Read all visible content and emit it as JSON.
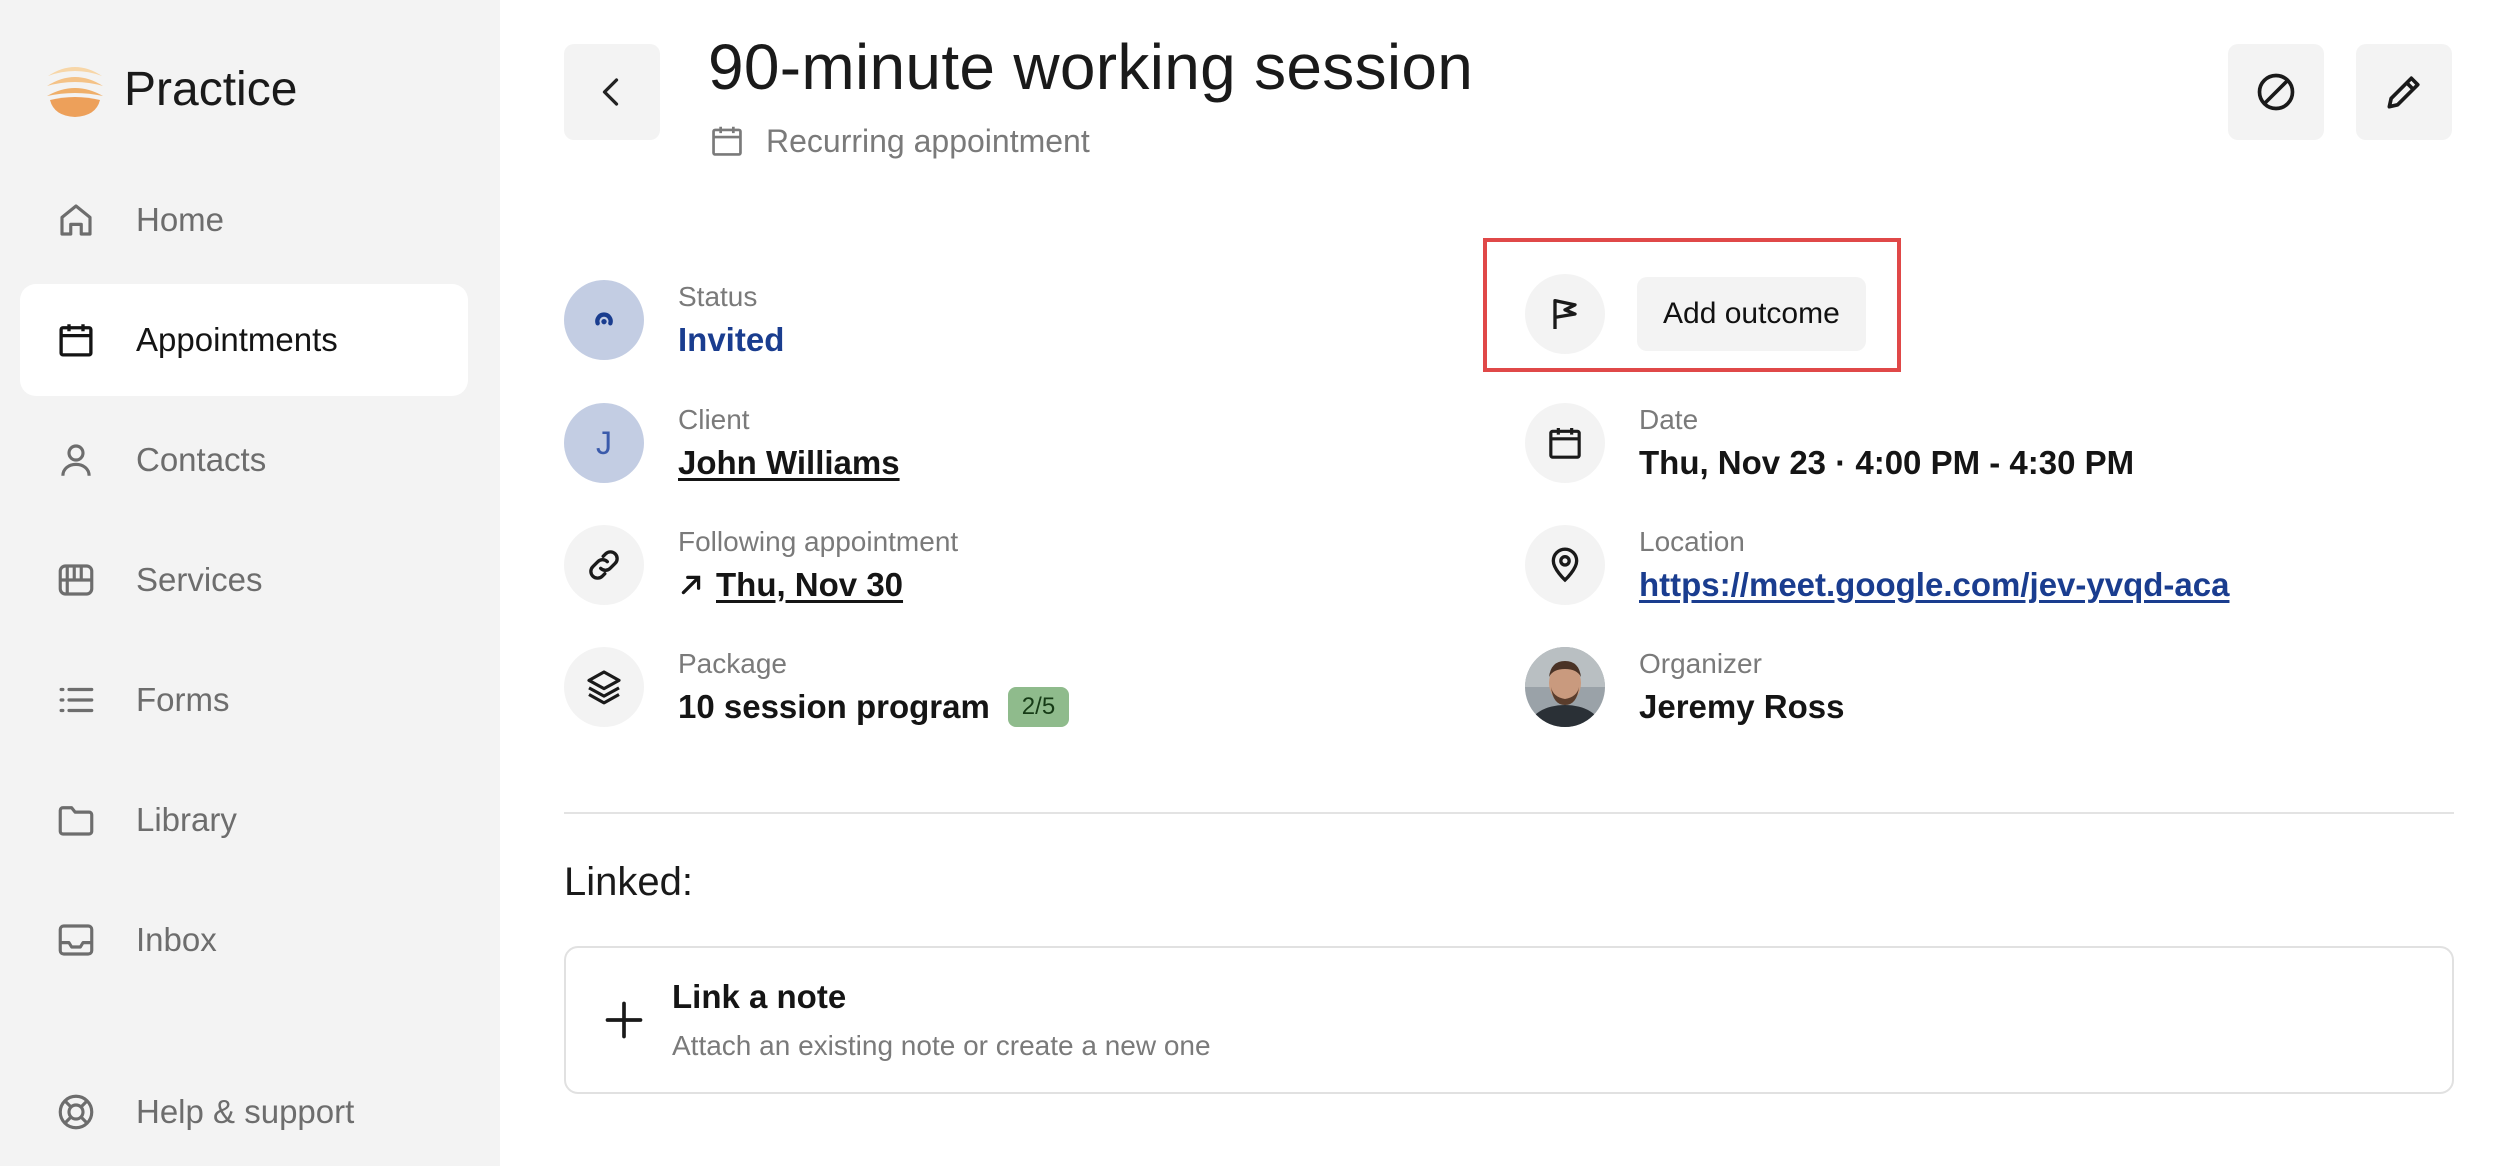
{
  "brand": {
    "name": "Practice"
  },
  "sidebar": {
    "items": [
      {
        "label": "Home",
        "icon": "home-icon"
      },
      {
        "label": "Appointments",
        "icon": "calendar-icon",
        "active": true
      },
      {
        "label": "Contacts",
        "icon": "person-icon"
      },
      {
        "label": "Services",
        "icon": "services-icon"
      },
      {
        "label": "Forms",
        "icon": "list-icon"
      },
      {
        "label": "Library",
        "icon": "folder-icon"
      },
      {
        "label": "Inbox",
        "icon": "inbox-icon"
      },
      {
        "label": "Help & support",
        "icon": "lifebuoy-icon"
      }
    ]
  },
  "header": {
    "title": "90-minute working session",
    "subtitle": "Recurring appointment"
  },
  "details": {
    "status": {
      "label": "Status",
      "value": "Invited"
    },
    "client": {
      "label": "Client",
      "value": "John Williams",
      "initial": "J"
    },
    "following": {
      "label": "Following appointment",
      "value": "Thu, Nov 30"
    },
    "package": {
      "label": "Package",
      "value": "10 session program",
      "badge": "2/5"
    },
    "outcome": {
      "button": "Add outcome"
    },
    "date": {
      "label": "Date",
      "value": "Thu, Nov 23 · 4:00 PM - 4:30 PM"
    },
    "location": {
      "label": "Location",
      "value": "https://meet.google.com/jev-yvqd-aca"
    },
    "organizer": {
      "label": "Organizer",
      "value": "Jeremy Ross"
    }
  },
  "linked": {
    "heading": "Linked:",
    "card_title": "Link a note",
    "card_subtitle": "Attach an existing note or create a new one"
  },
  "colors": {
    "sidebar_bg": "#f3f3f3",
    "status_blue": "#1a3d8f",
    "badge_green": "#8fbb8c",
    "highlight_red": "#e04848"
  }
}
